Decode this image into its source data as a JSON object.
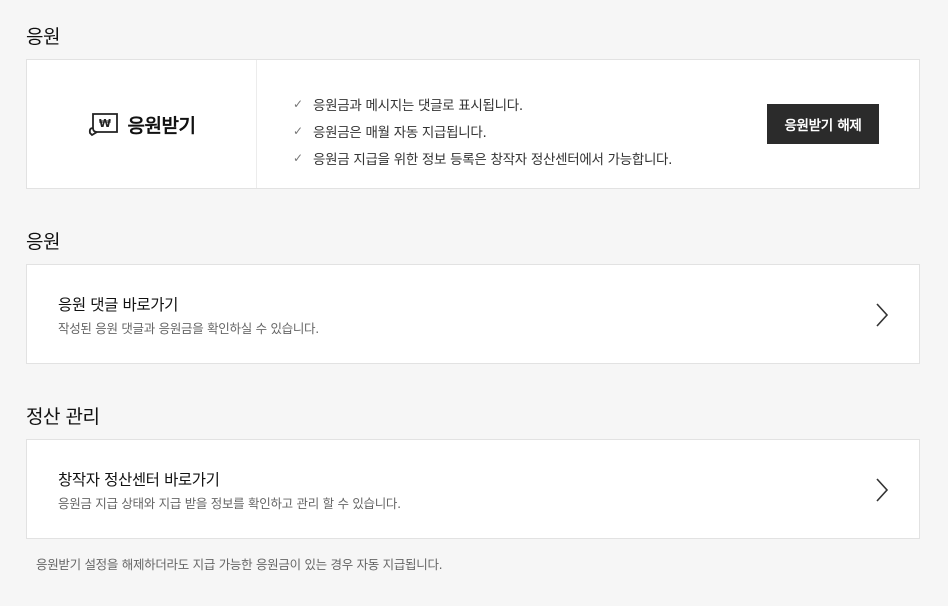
{
  "support": {
    "section_title": "응원",
    "label": "응원받기",
    "notes": [
      "응원금과 메시지는 댓글로 표시됩니다.",
      "응원금은 매월 자동 지급됩니다.",
      "응원금 지급을 위한 정보 등록은 창작자 정산센터에서 가능합니다."
    ],
    "disable_button": "응원받기 해제",
    "icon": "bill-won-icon",
    "icon_glyph": "₩"
  },
  "comments": {
    "section_title": "응원",
    "title": "응원 댓글 바로가기",
    "description": "작성된 응원 댓글과 응원금을 확인하실 수 있습니다."
  },
  "settlement": {
    "section_title": "정산 관리",
    "title": "창작자 정산센터 바로가기",
    "description": "응원금 지급 상태와 지급 받을 정보를 확인하고 관리 할 수 있습니다."
  },
  "footnote": "응원받기 설정을 해제하더라도 지급 가능한 응원금이 있는 경우 자동 지급됩니다."
}
